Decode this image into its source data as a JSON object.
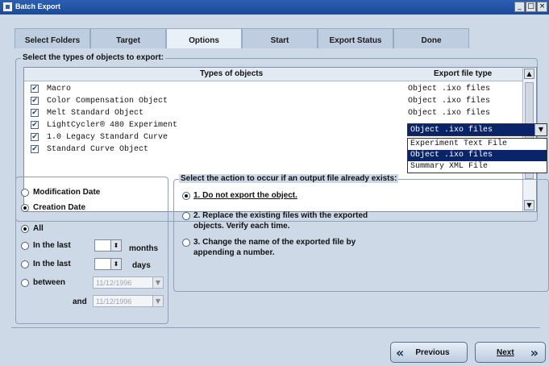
{
  "window": {
    "title": "Batch Export",
    "buttons": [
      "_",
      "□",
      "×"
    ]
  },
  "tabs": [
    {
      "label": "Select Folders"
    },
    {
      "label": "Target"
    },
    {
      "label": "Options"
    },
    {
      "label": "Start"
    },
    {
      "label": "Export Status"
    },
    {
      "label": "Done"
    }
  ],
  "active_tab": "Options",
  "objects_group": {
    "legend": "Select the types of objects to export:",
    "col_types": "Types of objects",
    "col_export": "Export file type",
    "rows": [
      {
        "name": "Macro",
        "export": "Object .ixo files",
        "checked": true
      },
      {
        "name": "Color Compensation Object",
        "export": "Object .ixo files",
        "checked": true
      },
      {
        "name": "Melt Standard Object",
        "export": "Object .ixo files",
        "checked": true
      },
      {
        "name": "LightCycler® 480 Experiment",
        "export": "Object .ixo files",
        "checked": true
      },
      {
        "name": "1.0 Legacy Standard Curve",
        "export": "",
        "checked": true
      },
      {
        "name": "Standard Curve Object",
        "export": "",
        "checked": true
      }
    ],
    "dropdown": {
      "selected": "Object .ixo files",
      "options": [
        "Experiment Text File",
        "Object .ixo files",
        "Summary XML File"
      ]
    }
  },
  "date_filter": {
    "modification_date": "Modification Date",
    "creation_date": "Creation Date",
    "all": "All",
    "in_the_last": "In the last",
    "months": "months",
    "days": "days",
    "between": "between",
    "and": "and",
    "date_from": "11/12/1996",
    "date_to": "11/12/1996"
  },
  "action_group": {
    "legend": "Select the action to occur if an output file already exists:",
    "option1": "1. Do not export the object.",
    "option2_line1": "2. Replace the existing files with the exported",
    "option2_line2": "objects. Verify each time.",
    "option3_line1": "3. Change the name of the exported file by",
    "option3_line2": "appending a number."
  },
  "nav": {
    "previous": "Previous",
    "next": "Next"
  },
  "colors": {
    "titlebar": "#2b5fb4",
    "background": "#cdd9e6",
    "selection": "#0a246a"
  }
}
